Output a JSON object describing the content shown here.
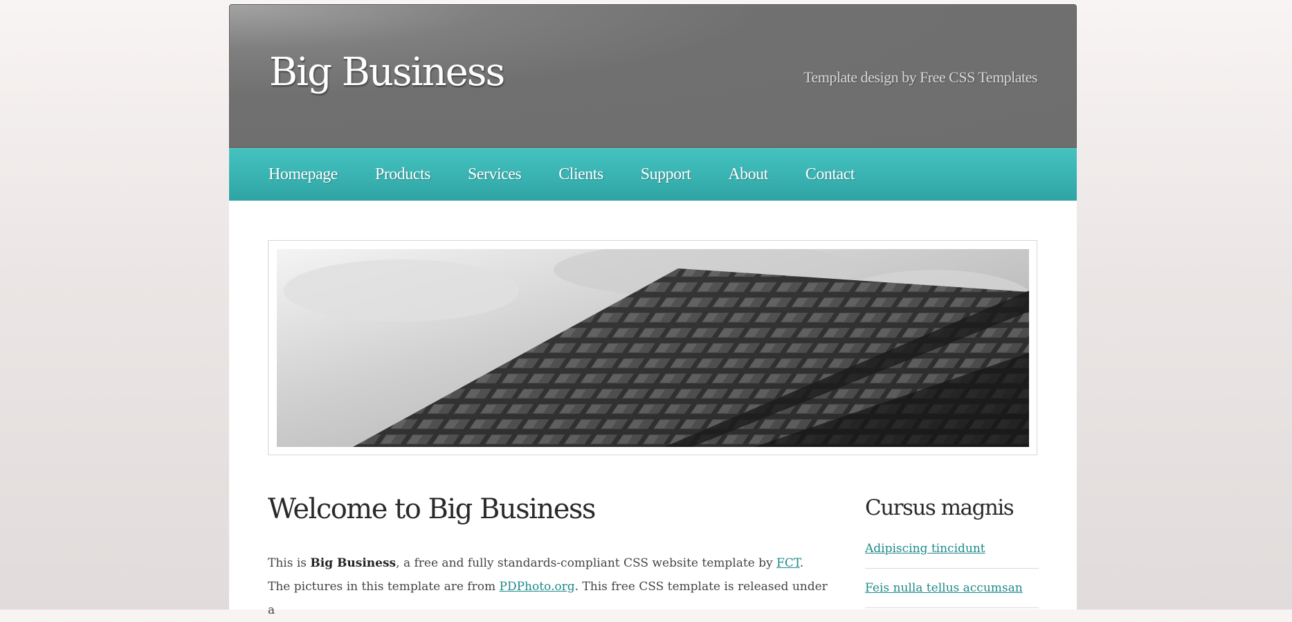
{
  "header": {
    "logo": "Big Business",
    "tagline": "Template design by Free CSS Templates"
  },
  "menu": {
    "items": [
      {
        "label": "Homepage"
      },
      {
        "label": "Products"
      },
      {
        "label": "Services"
      },
      {
        "label": "Clients"
      },
      {
        "label": "Support"
      },
      {
        "label": "About"
      },
      {
        "label": "Contact"
      }
    ]
  },
  "content": {
    "title": "Welcome to Big Business",
    "para_1": "This is ",
    "para_bold": "Big Business",
    "para_2": ", a free and fully standards-compliant CSS website template by ",
    "link_fct": "FCT",
    "para_3": ". The pictures in this template are from ",
    "link_pdphoto": "PDPhoto.org",
    "para_4": ". This free CSS template is released under a"
  },
  "sidebar": {
    "title": "Cursus magnis",
    "links": [
      {
        "label": "Adipiscing tincidunt"
      },
      {
        "label": "Feis nulla tellus accumsan"
      }
    ]
  },
  "colors": {
    "header_bg": "#707070",
    "menu_bg": "#38b1b0",
    "link": "#1e8a8a"
  }
}
